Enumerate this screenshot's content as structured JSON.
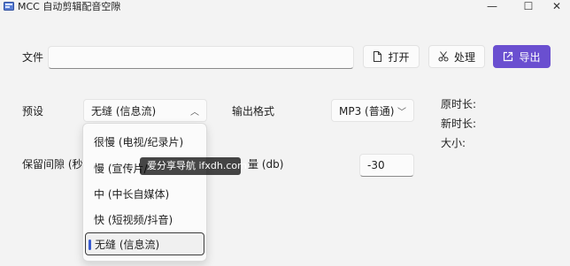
{
  "window": {
    "title": "MCC 自动剪辑配音空隙",
    "minimize_glyph": "—",
    "maximize_glyph": "☐",
    "close_glyph": "✕"
  },
  "file_row": {
    "label": "文件",
    "value": "",
    "open_label": "打开",
    "process_label": "处理",
    "export_label": "导出"
  },
  "preset": {
    "label": "预设",
    "selected": "无缝 (信息流)",
    "options": [
      "很慢 (电视/纪录片)",
      "慢 (宣传片/",
      "中 (中长自媒体)",
      "快 (短视频/抖音)",
      "无缝 (信息流)"
    ],
    "selected_index": 4
  },
  "output_format": {
    "label": "输出格式",
    "selected": "MP3 (普通)"
  },
  "info": {
    "original_duration": "原时长:",
    "new_duration": "新时长:",
    "size": "大小:"
  },
  "gap": {
    "label": "保留间隙 (秒)"
  },
  "volume": {
    "label_fragment": "量 (db)",
    "value": "-30"
  },
  "watermark": {
    "text": "爱分享导航 ifxdh.com"
  },
  "colors": {
    "accent": "#6a4fd0",
    "background": "#f3f3f3",
    "selection_indicator": "#3a5bd0"
  },
  "icons": {
    "app": "app-icon",
    "open": "document-icon",
    "process": "scissors-icon",
    "export": "export-icon",
    "dropdown": "chevron-down-icon"
  }
}
